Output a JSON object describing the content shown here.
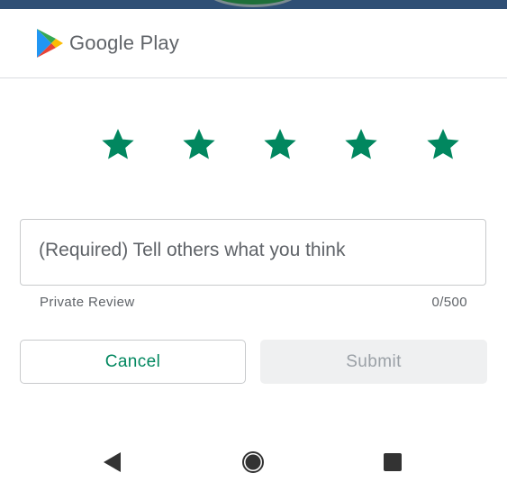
{
  "header": {
    "brand": "Google Play"
  },
  "rating": {
    "stars": [
      {
        "icon": "star-icon",
        "filled": true
      },
      {
        "icon": "star-icon",
        "filled": true
      },
      {
        "icon": "star-icon",
        "filled": true
      },
      {
        "icon": "star-icon",
        "filled": true
      },
      {
        "icon": "star-icon",
        "filled": true
      }
    ],
    "value": 5,
    "max": 5,
    "color": "#01875f"
  },
  "review": {
    "placeholder": "(Required) Tell others what you think",
    "value": "",
    "privacy_label": "Private Review",
    "char_count": "0/500"
  },
  "actions": {
    "cancel_label": "Cancel",
    "submit_label": "Submit"
  },
  "navbar": {
    "back_icon": "back-triangle-icon",
    "home_icon": "home-circle-icon",
    "recents_icon": "recents-square-icon"
  },
  "colors": {
    "accent": "#01875f",
    "disabled_bg": "#eff0f1",
    "disabled_text": "#9aa0a6",
    "border": "#c8cacc",
    "top_strip": "#2f4f75"
  }
}
